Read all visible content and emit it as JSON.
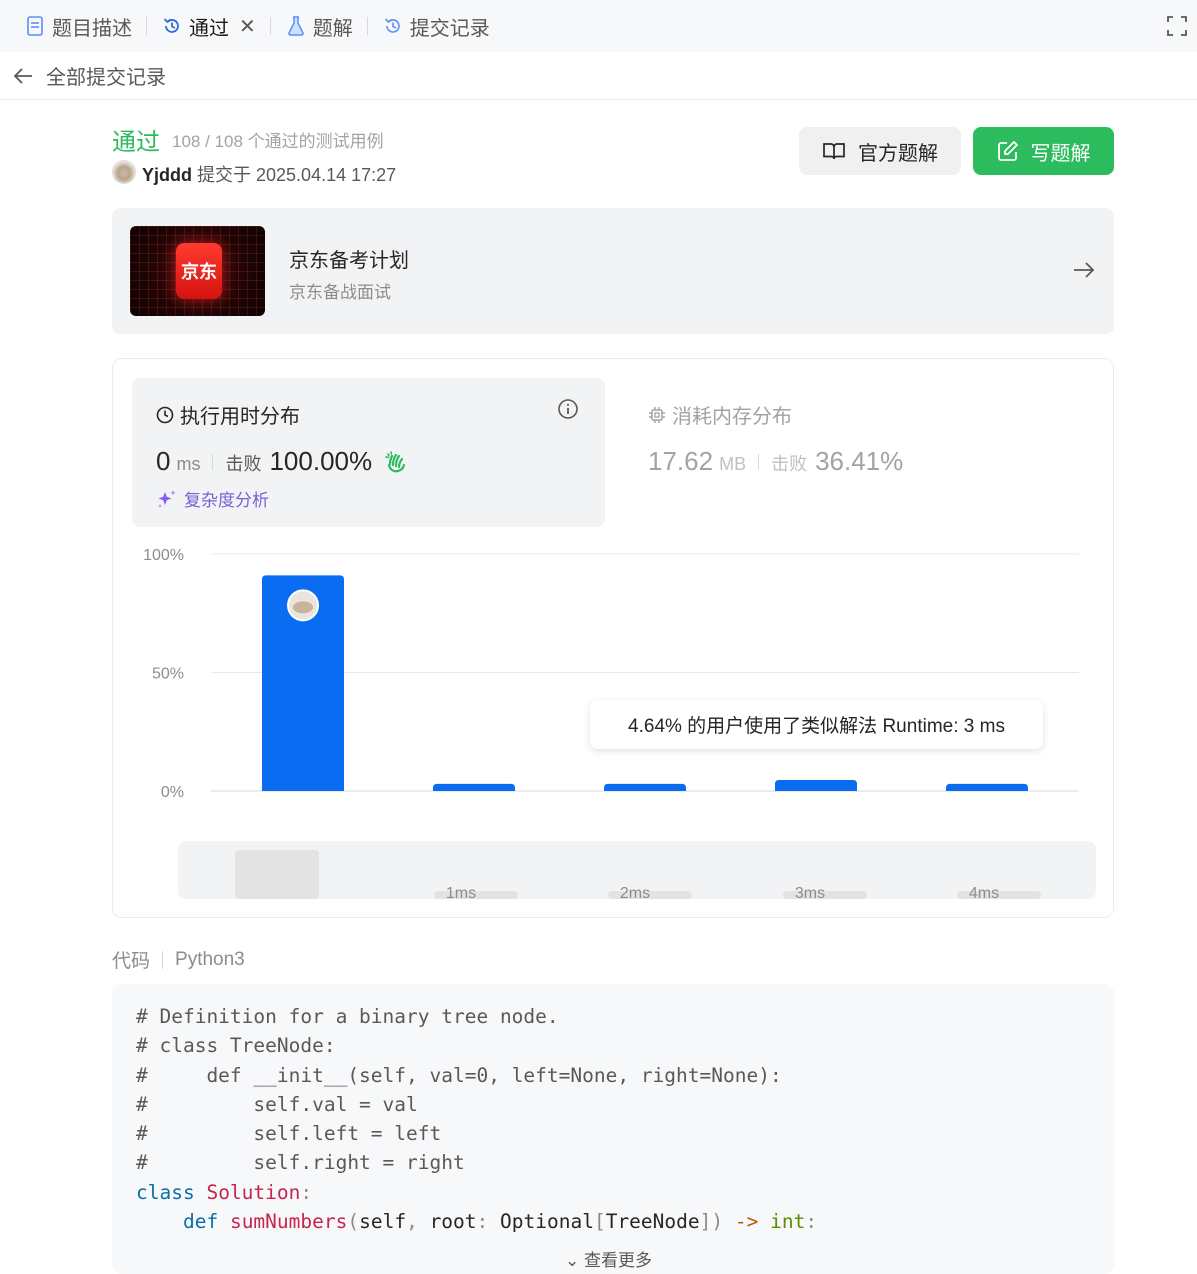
{
  "tabs": [
    {
      "label": "题目描述",
      "icon": "document-icon"
    },
    {
      "label": "通过",
      "icon": "history-icon",
      "active": true
    },
    {
      "label": "题解",
      "icon": "flask-icon"
    },
    {
      "label": "提交记录",
      "icon": "history-icon"
    }
  ],
  "back": {
    "label": "全部提交记录"
  },
  "submission": {
    "status": "通过",
    "passed": "108 / 108 个通过的测试用例",
    "user": "Yjddd",
    "submitted_at": "提交于 2025.04.14 17:27"
  },
  "actions": {
    "official": "官方题解",
    "write": "写题解"
  },
  "banner": {
    "logo": "京东",
    "title": "京东备考计划",
    "subtitle": "京东备战面试"
  },
  "runtime": {
    "title": "执行用时分布",
    "value": "0",
    "unit": "ms",
    "beat_label": "击败",
    "beat": "100.00%",
    "complexity": "复杂度分析"
  },
  "memory": {
    "title": "消耗内存分布",
    "value": "17.62",
    "unit": "MB",
    "beat_label": "击败",
    "beat": "36.41%"
  },
  "tooltip": "4.64% 的用户使用了类似解法 Runtime: 3 ms",
  "chart_data": {
    "type": "bar",
    "categories": [
      "",
      "1ms",
      "2ms",
      "3ms",
      "4ms"
    ],
    "values": [
      91,
      3,
      3,
      4.64,
      3
    ],
    "ylim": [
      0,
      100
    ],
    "yticks": [
      "0%",
      "50%",
      "100%"
    ],
    "grid": true,
    "highlight_index": 0
  },
  "code": {
    "label": "代码",
    "language": "Python3",
    "lines": [
      [
        [
          "c",
          "# Definition for a binary tree node."
        ]
      ],
      [
        [
          "c",
          "# class TreeNode:"
        ]
      ],
      [
        [
          "c",
          "#     def __init__(self, val=0, left=None, right=None):"
        ]
      ],
      [
        [
          "c",
          "#         self.val = val"
        ]
      ],
      [
        [
          "c",
          "#         self.left = left"
        ]
      ],
      [
        [
          "c",
          "#         self.right = right"
        ]
      ],
      [
        [
          "kw",
          "class"
        ],
        [
          "t",
          " "
        ],
        [
          "cls",
          "Solution"
        ],
        [
          "pn",
          ":"
        ]
      ],
      [
        [
          "t",
          "    "
        ],
        [
          "kw",
          "def"
        ],
        [
          "t",
          " "
        ],
        [
          "fn",
          "sumNumbers"
        ],
        [
          "pn",
          "("
        ],
        [
          "ty",
          "self"
        ],
        [
          "pn",
          ","
        ],
        [
          "ty",
          " root"
        ],
        [
          "pn",
          ":"
        ],
        [
          "ty",
          " Optional"
        ],
        [
          "pn",
          "["
        ],
        [
          "ty",
          "TreeNode"
        ],
        [
          "pn",
          "])"
        ],
        [
          "t",
          " "
        ],
        [
          "op",
          "->"
        ],
        [
          "t",
          " "
        ],
        [
          "blt",
          "int"
        ],
        [
          "pn",
          ":"
        ]
      ]
    ],
    "more": "⌄ 查看更多"
  },
  "colors": {
    "accent": "#2cbb5d",
    "bar": "#0a6cf0",
    "purple": "#7b5fd6"
  }
}
